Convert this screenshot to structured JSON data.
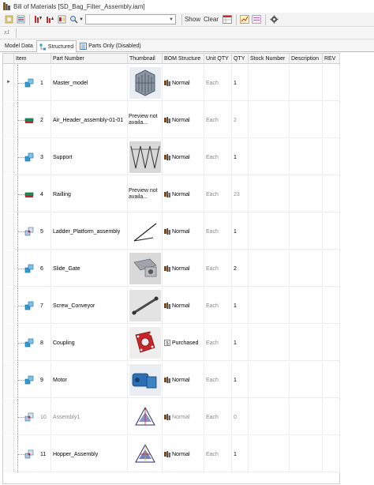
{
  "window": {
    "title": "Bill of Materials [SD_Bag_Filter_Assembly.iam]"
  },
  "toolbar": {
    "combo_value": "",
    "show_label": "Show",
    "clear_label": "Clear"
  },
  "formula_bar": {
    "fx_label": "x1"
  },
  "tabs": [
    {
      "label": "Model Data"
    },
    {
      "label": "Structured"
    },
    {
      "label": "Parts Only (Disabled)"
    }
  ],
  "table": {
    "columns": [
      "Item",
      "Part Number",
      "Thumbnail",
      "BOM Structure",
      "Unit QTY",
      "QTY",
      "Stock Number",
      "Description",
      "REV"
    ],
    "rows": [
      {
        "item": "1",
        "part_number": "Master_model",
        "thumbnail": "master-model-thumbnail",
        "bom_structure": "Normal",
        "unit_qty": "Each",
        "qty": "1",
        "icon": "assembly-icon",
        "muted": false
      },
      {
        "item": "2",
        "part_number": "Air_Header_assembly-01-01",
        "thumbnail_text": "Preview not availa...",
        "bom_structure": "Normal",
        "unit_qty": "Each",
        "qty": "2",
        "icon": "part-icon",
        "muted": false
      },
      {
        "item": "3",
        "part_number": "Support",
        "thumbnail": "support-thumbnail",
        "bom_structure": "Normal",
        "unit_qty": "Each",
        "qty": "1",
        "icon": "assembly-icon",
        "muted": false
      },
      {
        "item": "4",
        "part_number": "Railling",
        "thumbnail_text": "Preview not availa...",
        "bom_structure": "Normal",
        "unit_qty": "Each",
        "qty": "23",
        "icon": "part-icon",
        "muted": false
      },
      {
        "item": "5",
        "part_number": "Ladder_Platform_assembly",
        "thumbnail": "ladder-thumbnail",
        "bom_structure": "Normal",
        "unit_qty": "Each",
        "qty": "1",
        "icon": "weldment-icon",
        "muted": false
      },
      {
        "item": "6",
        "part_number": "Slide_Gate",
        "thumbnail": "slide-gate-thumbnail",
        "bom_structure": "Normal",
        "unit_qty": "Each",
        "qty": "2",
        "icon": "assembly-icon",
        "muted": false
      },
      {
        "item": "7",
        "part_number": "Screw_Conveyor",
        "thumbnail": "screw-conveyor-thumbnail",
        "bom_structure": "Normal",
        "unit_qty": "Each",
        "qty": "1",
        "icon": "assembly-icon",
        "muted": false
      },
      {
        "item": "8",
        "part_number": "Coupling",
        "thumbnail": "coupling-thumbnail",
        "bom_structure": "Purchased",
        "unit_qty": "Each",
        "qty": "1",
        "icon": "assembly-icon",
        "muted": false
      },
      {
        "item": "9",
        "part_number": "Motor",
        "thumbnail": "motor-thumbnail",
        "bom_structure": "Normal",
        "unit_qty": "Each",
        "qty": "1",
        "icon": "assembly-icon",
        "muted": false
      },
      {
        "item": "10",
        "part_number": "Assembly1",
        "thumbnail": "assembly1-thumbnail",
        "bom_structure": "Normal",
        "unit_qty": "Each",
        "qty": "0",
        "icon": "weldment-icon",
        "muted": true
      },
      {
        "item": "11",
        "part_number": "Hopper_Assembly",
        "thumbnail": "hopper-thumbnail",
        "bom_structure": "Normal",
        "unit_qty": "Each",
        "qty": "1",
        "icon": "weldment-icon",
        "muted": false
      }
    ]
  },
  "colors": {
    "assembly_icon": "#2f9ad6",
    "part_icon": "#1f8a5c",
    "coupling_red": "#c8242a",
    "motor_blue": "#2a6fb5"
  }
}
